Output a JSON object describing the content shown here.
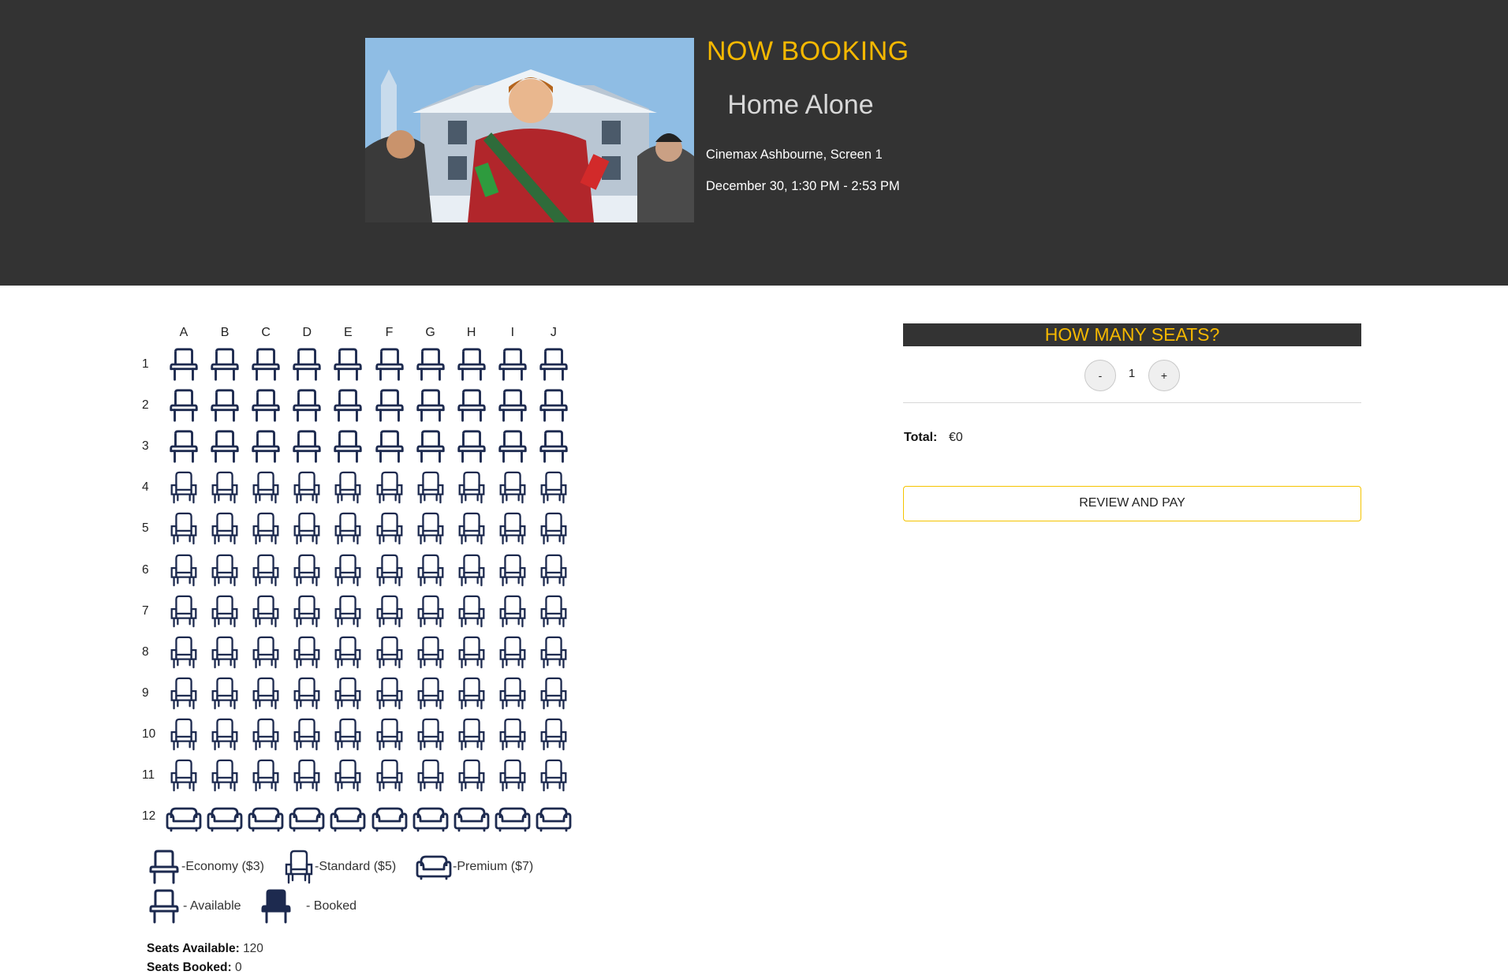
{
  "header": {
    "now_booking": "NOW BOOKING",
    "movie_title": "Home Alone",
    "cinema": "Cinemax Ashbourne, Screen 1",
    "showtime": "December 30, 1:30 PM - 2:53 PM",
    "background_color": "#333333",
    "accent_color": "#f5b800"
  },
  "seat_map": {
    "columns": [
      "A",
      "B",
      "C",
      "D",
      "E",
      "F",
      "G",
      "H",
      "I",
      "J"
    ],
    "rows": [
      {
        "label": "1",
        "type": "economy"
      },
      {
        "label": "2",
        "type": "economy"
      },
      {
        "label": "3",
        "type": "economy"
      },
      {
        "label": "4",
        "type": "standard"
      },
      {
        "label": "5",
        "type": "standard"
      },
      {
        "label": "6",
        "type": "standard"
      },
      {
        "label": "7",
        "type": "standard"
      },
      {
        "label": "8",
        "type": "standard"
      },
      {
        "label": "9",
        "type": "standard"
      },
      {
        "label": "10",
        "type": "standard"
      },
      {
        "label": "11",
        "type": "standard"
      },
      {
        "label": "12",
        "type": "premium"
      }
    ],
    "seat_color": "#1d2a4f",
    "booked_seats": []
  },
  "legend": {
    "economy": "-Economy ($3)",
    "standard": "-Standard ($5)",
    "premium": "-Premium ($7)",
    "available": "- Available",
    "booked": "- Booked"
  },
  "stats": {
    "available_label": "Seats Available:",
    "available_value": "120",
    "booked_label": "Seats Booked:",
    "booked_value": "0"
  },
  "booking_panel": {
    "heading": "HOW MANY SEATS?",
    "minus_label": "-",
    "plus_label": "+",
    "quantity": "1",
    "total_label": "Total:",
    "total_value": "€0",
    "review_button": "REVIEW AND PAY"
  }
}
